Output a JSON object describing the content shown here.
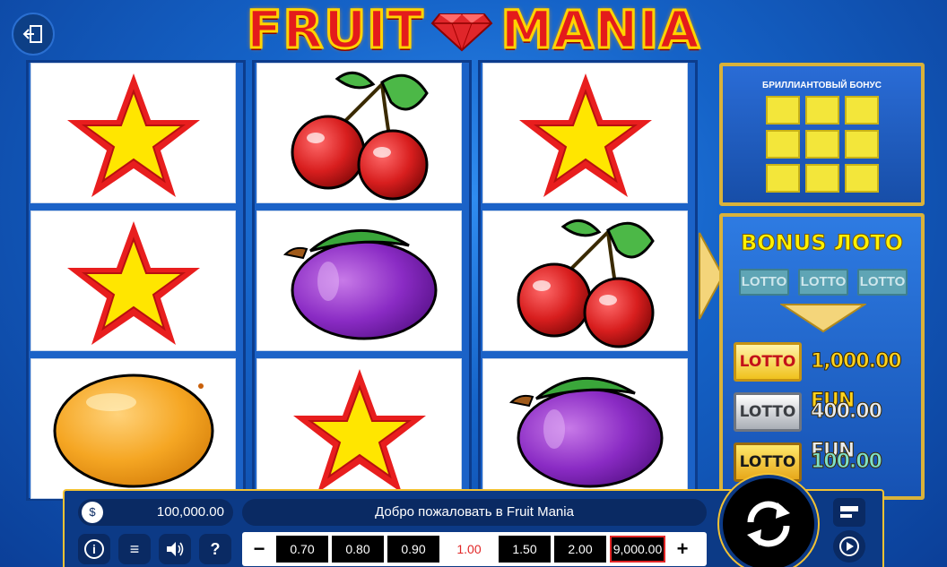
{
  "logo": {
    "word1": "FRUIT",
    "word2": "MANIA"
  },
  "reels": [
    [
      "star",
      "star",
      "orange"
    ],
    [
      "cherries",
      "plum",
      "star"
    ],
    [
      "star",
      "cherries",
      "plum"
    ]
  ],
  "diamond_bonus": {
    "title": "БРИЛЛИАНТОВЫЙ БОНУС",
    "slots": 9
  },
  "bonus_lotto": {
    "title": "BONUS ЛОТО",
    "slots": [
      "LOTTO",
      "LOTTO",
      "LOTTO"
    ],
    "prizes": [
      {
        "badge": "LOTTO",
        "value": "1,000.00 FUN",
        "tier": "gold"
      },
      {
        "badge": "LOTTO",
        "value": "400.00 FUN",
        "tier": "silver"
      },
      {
        "badge": "LOTTO",
        "value": "100.00 FUN",
        "tier": "bronze"
      }
    ]
  },
  "bottom": {
    "balance": "100,000.00",
    "balance_icon": "money-bag-icon",
    "message": "Добро пожаловать в Fruit Mania",
    "buttons": {
      "info": "i",
      "menu": "≡",
      "sound": "🔊",
      "help": "?"
    },
    "bet_minus": "−",
    "bet_plus": "+",
    "bets": [
      "0.70",
      "0.80",
      "0.90",
      "1.00",
      "1.50",
      "2.00"
    ],
    "selected_bet": "1.00",
    "total_bet": "9,000.00"
  },
  "colors": {
    "accent_gold": "#f2c233",
    "selected_red": "#e12626",
    "lotto_gold": "#fff200"
  }
}
